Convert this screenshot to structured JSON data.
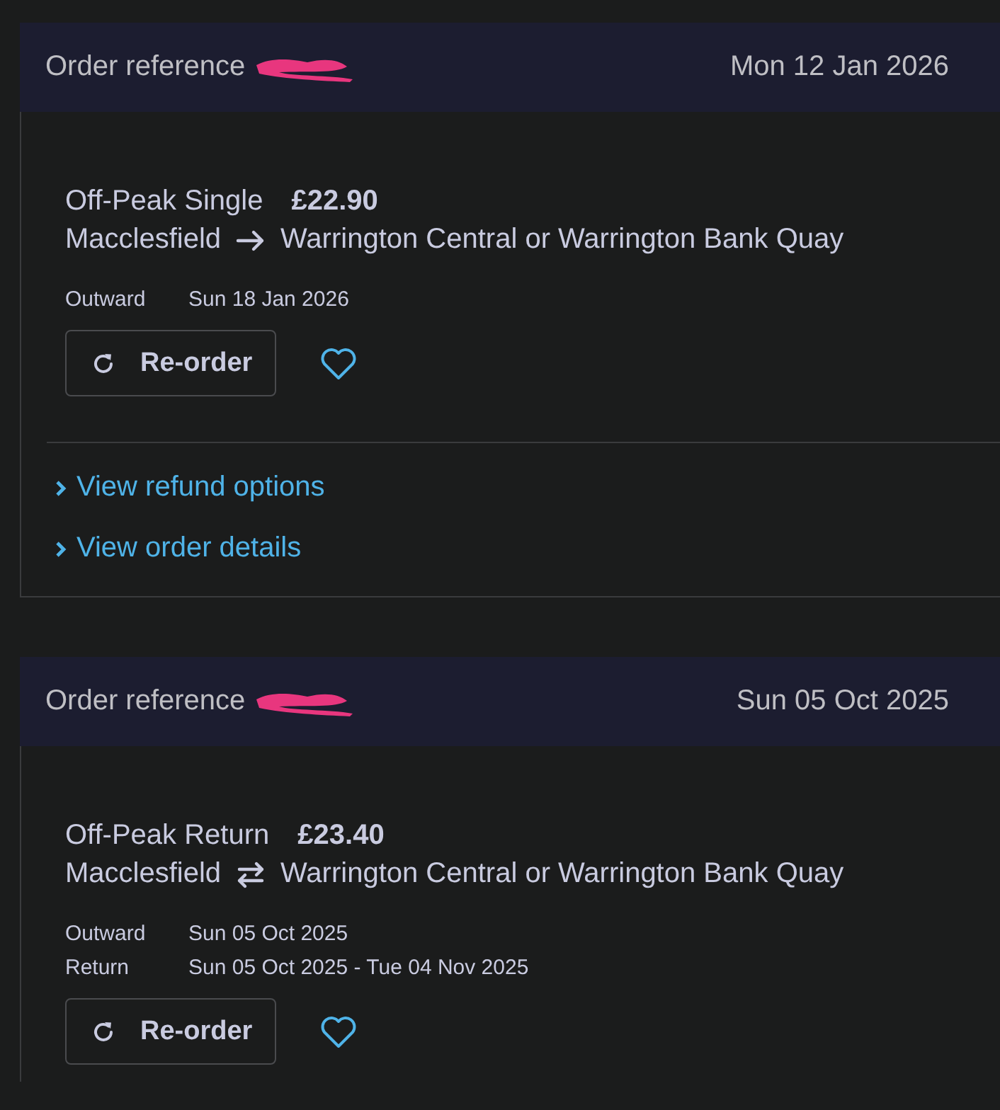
{
  "orders": [
    {
      "reference_label": "Order reference",
      "date": "Mon 12 Jan 2026",
      "ticket": "Off-Peak Single",
      "price": "£22.90",
      "origin": "Macclesfield",
      "destination": "Warrington Central or Warrington Bank Quay",
      "journey": {
        "kind": "single"
      },
      "legs": [
        {
          "label": "Outward",
          "dates": "Sun 18 Jan 2026"
        }
      ],
      "reorder": "Re-order",
      "favourite": false,
      "links": [
        "View refund options",
        "View order details"
      ]
    },
    {
      "reference_label": "Order reference",
      "date": "Sun 05 Oct 2025",
      "ticket": "Off-Peak Return",
      "price": "£23.40",
      "origin": "Macclesfield",
      "destination": "Warrington Central or Warrington Bank Quay",
      "journey": {
        "kind": "return"
      },
      "legs": [
        {
          "label": "Outward",
          "dates": "Sun 05 Oct 2025"
        },
        {
          "label": "Return",
          "dates": "Sun 05 Oct 2025 - Tue 04 Nov 2025"
        }
      ],
      "reorder": "Re-order",
      "favourite": false
    }
  ]
}
